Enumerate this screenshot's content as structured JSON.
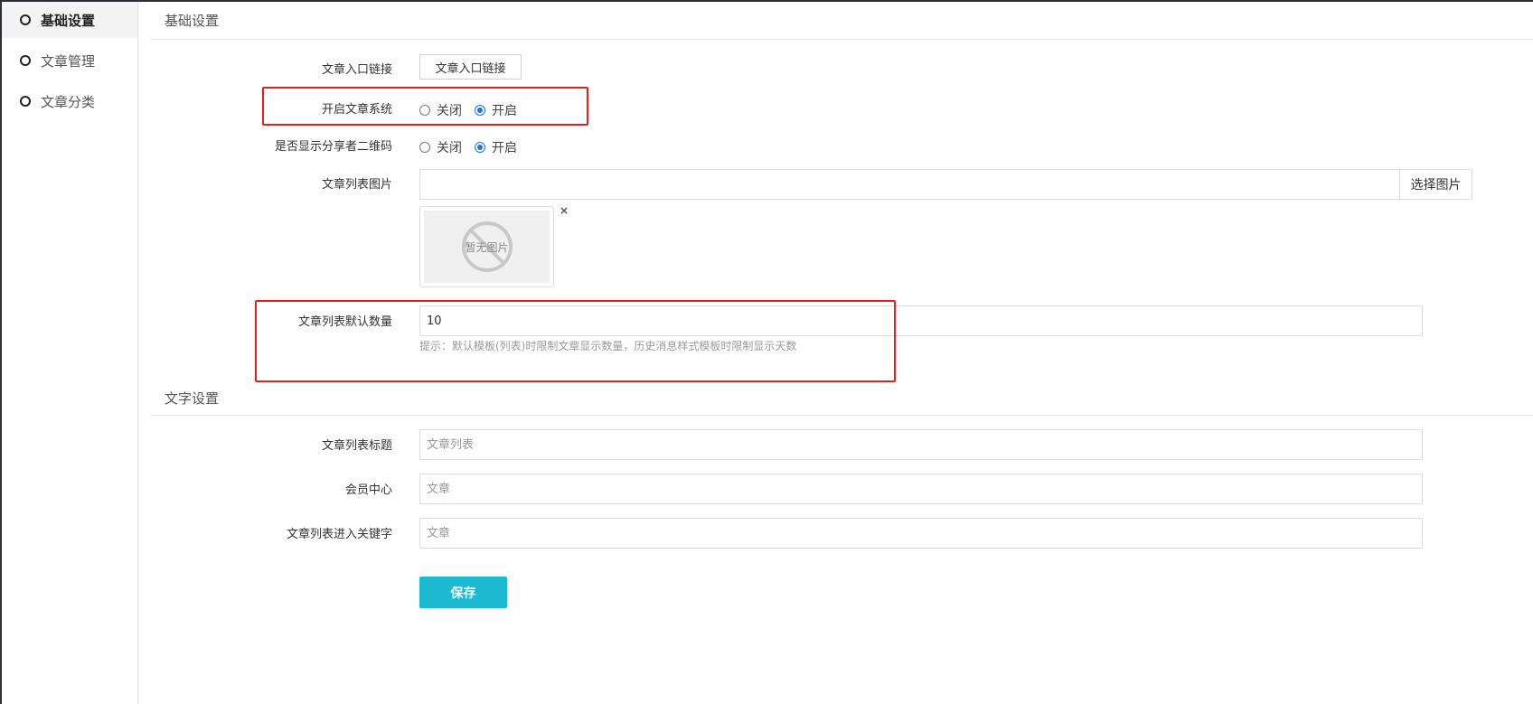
{
  "sidebar": {
    "items": [
      {
        "label": "基础设置",
        "active": true
      },
      {
        "label": "文章管理",
        "active": false
      },
      {
        "label": "文章分类",
        "active": false
      }
    ]
  },
  "basic": {
    "section_title": "基础设置",
    "entry_link": {
      "label": "文章入口链接",
      "button": "文章入口链接"
    },
    "enable_article": {
      "label": "开启文章系统",
      "off": "关闭",
      "on": "开启",
      "selected": "开启"
    },
    "show_qr": {
      "label": "是否显示分享者二维码",
      "off": "关闭",
      "on": "开启",
      "selected": "开启"
    },
    "list_image": {
      "label": "文章列表图片",
      "value": "",
      "button": "选择图片",
      "placeholder_text": "暂无图片",
      "remove": "×"
    },
    "default_count": {
      "label": "文章列表默认数量",
      "value": "10",
      "hint": "提示：默认模板(列表)时限制文章显示数量，历史消息样式模板时限制显示天数"
    }
  },
  "text": {
    "section_title": "文字设置",
    "list_title": {
      "label": "文章列表标题",
      "placeholder": "文章列表"
    },
    "member_center": {
      "label": "会员中心",
      "placeholder": "文章"
    },
    "entry_keyword": {
      "label": "文章列表进入关键字",
      "placeholder": "文章"
    }
  },
  "actions": {
    "save": "保存"
  },
  "colors": {
    "highlight": "#e61e1e",
    "primary": "#1bb9d2",
    "radio": "#1a73e8"
  }
}
